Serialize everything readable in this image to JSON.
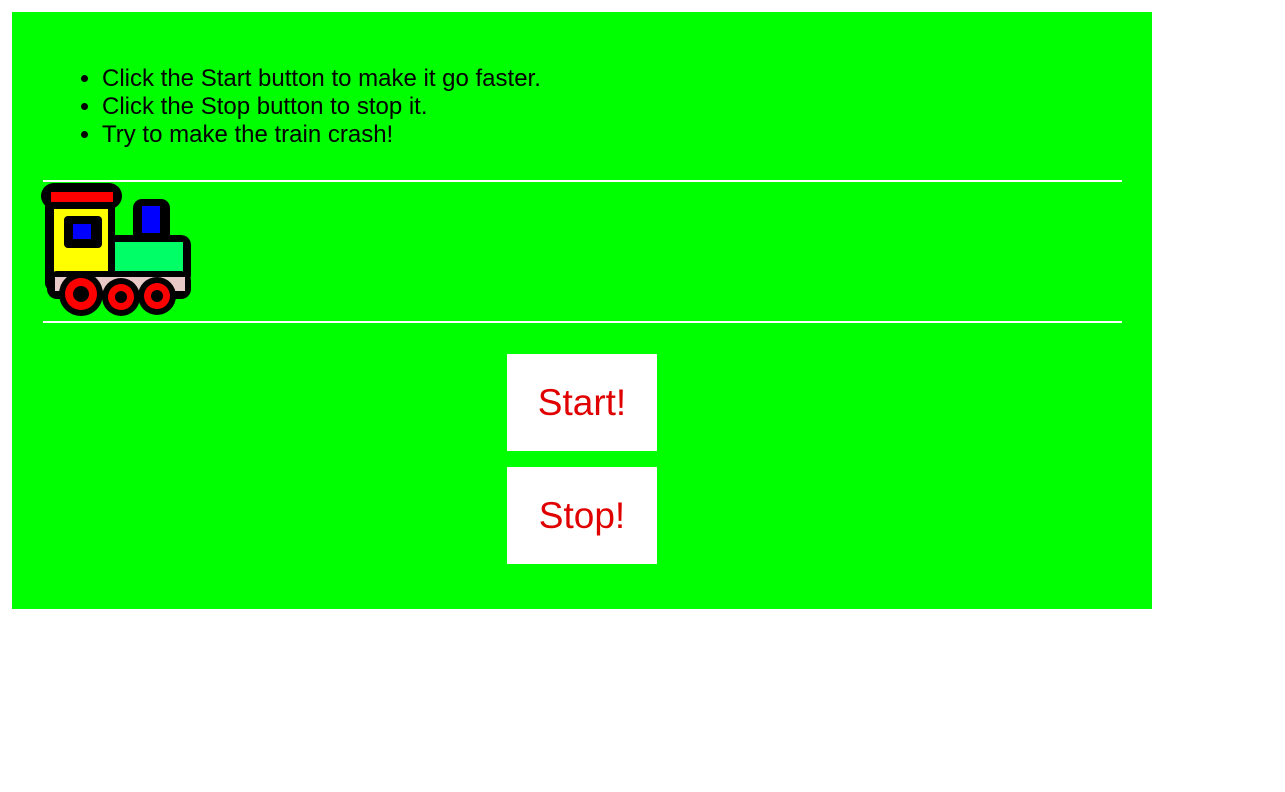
{
  "instructions": [
    "Click the Start button to make it go faster.",
    "Click the Stop button to stop it.",
    "Try to make the train crash!"
  ],
  "buttons": {
    "start_label": "Start!",
    "stop_label": "Stop!"
  },
  "colors": {
    "panel_background": "#00ff00",
    "button_text": "#e00000",
    "track_rail": "#ffffff"
  },
  "train": {
    "icon": "toy-train-icon"
  }
}
